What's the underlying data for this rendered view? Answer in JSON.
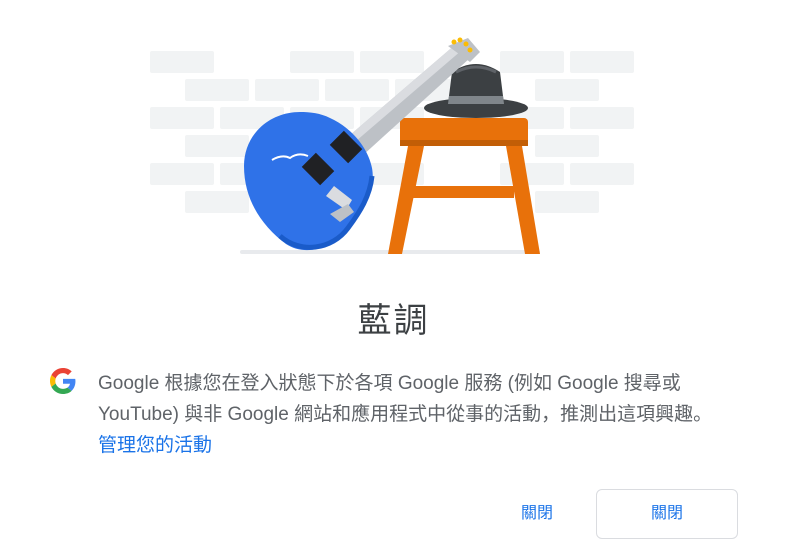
{
  "dialog": {
    "title": "藍調",
    "description": "Google 根據您在登入狀態下於各項 Google 服務 (例如 Google 搜尋或 YouTube) 與非 Google 網站和應用程式中從事的活動，推測出這項興趣。",
    "manage_link": "管理您的活動",
    "close_text_button": "關閉",
    "close_outline_button": "關閉"
  },
  "illustration": {
    "subject": "guitar-hat-stool",
    "colors": {
      "guitar": "#2f72e8",
      "stool": "#e8710a",
      "hat": "#3c4043",
      "bricks": "#f1f3f4"
    }
  },
  "icons": {
    "logo": "google-g-icon"
  }
}
